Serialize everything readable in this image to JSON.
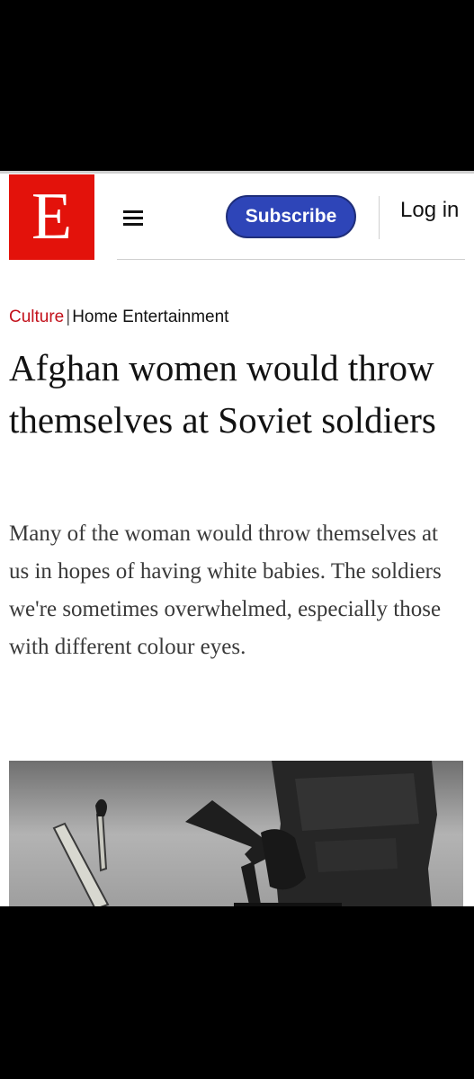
{
  "header": {
    "logo_letter": "E",
    "menu_icon": "hamburger-menu-icon",
    "subscribe_label": "Subscribe",
    "login_label": "Log in"
  },
  "breadcrumb": {
    "section": "Culture",
    "separator": "|",
    "subsection": "Home Entertainment"
  },
  "article": {
    "headline": "Afghan women would throw themselves at Soviet soldiers",
    "standfirst": "Many of the woman would throw themselves at us in hopes of having white babies. The soldiers we're sometimes overwhelmed, especially those with different colour eyes."
  },
  "colors": {
    "brand_red": "#e3120b",
    "subscribe_blue": "#2e45b8",
    "section_red": "#c3111b"
  }
}
